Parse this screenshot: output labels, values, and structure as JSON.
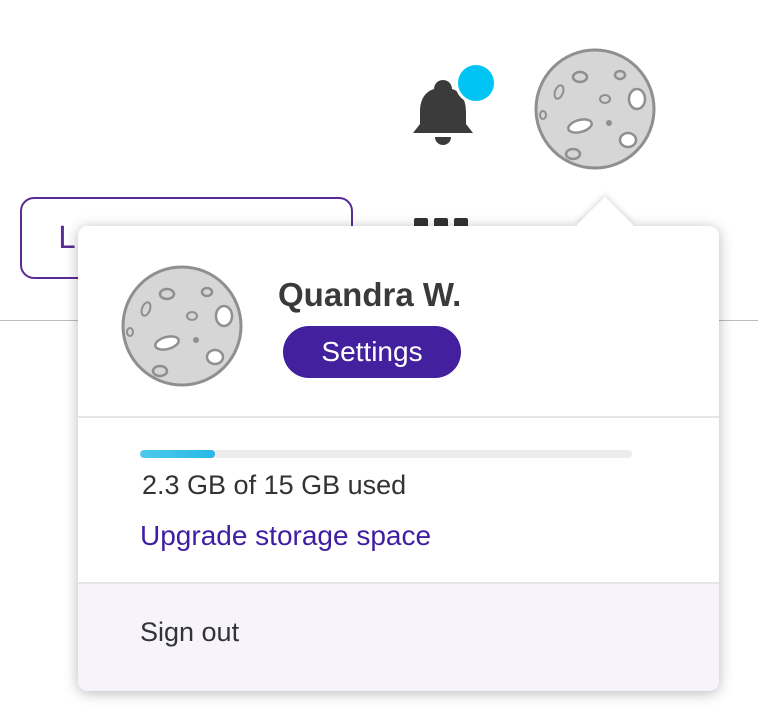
{
  "header": {
    "notifications_icon": "bell-icon",
    "notification_badge_color": "#00c4f4",
    "avatar_icon": "moon-avatar-icon"
  },
  "background": {
    "partial_button_label": "L",
    "apps_icon": "apps-grid-icon"
  },
  "account_menu": {
    "user_name": "Quandra W.",
    "avatar_icon": "moon-avatar-icon",
    "settings_label": "Settings",
    "storage": {
      "used_fraction": 0.153,
      "usage_text": "2.3 GB of 15 GB used",
      "upgrade_label": "Upgrade storage space"
    },
    "sign_out_label": "Sign out"
  },
  "colors": {
    "accent": "#42209e",
    "link": "#3f1ea3",
    "progress": "#27b9e7",
    "signout_bg": "#f6f3fc"
  }
}
